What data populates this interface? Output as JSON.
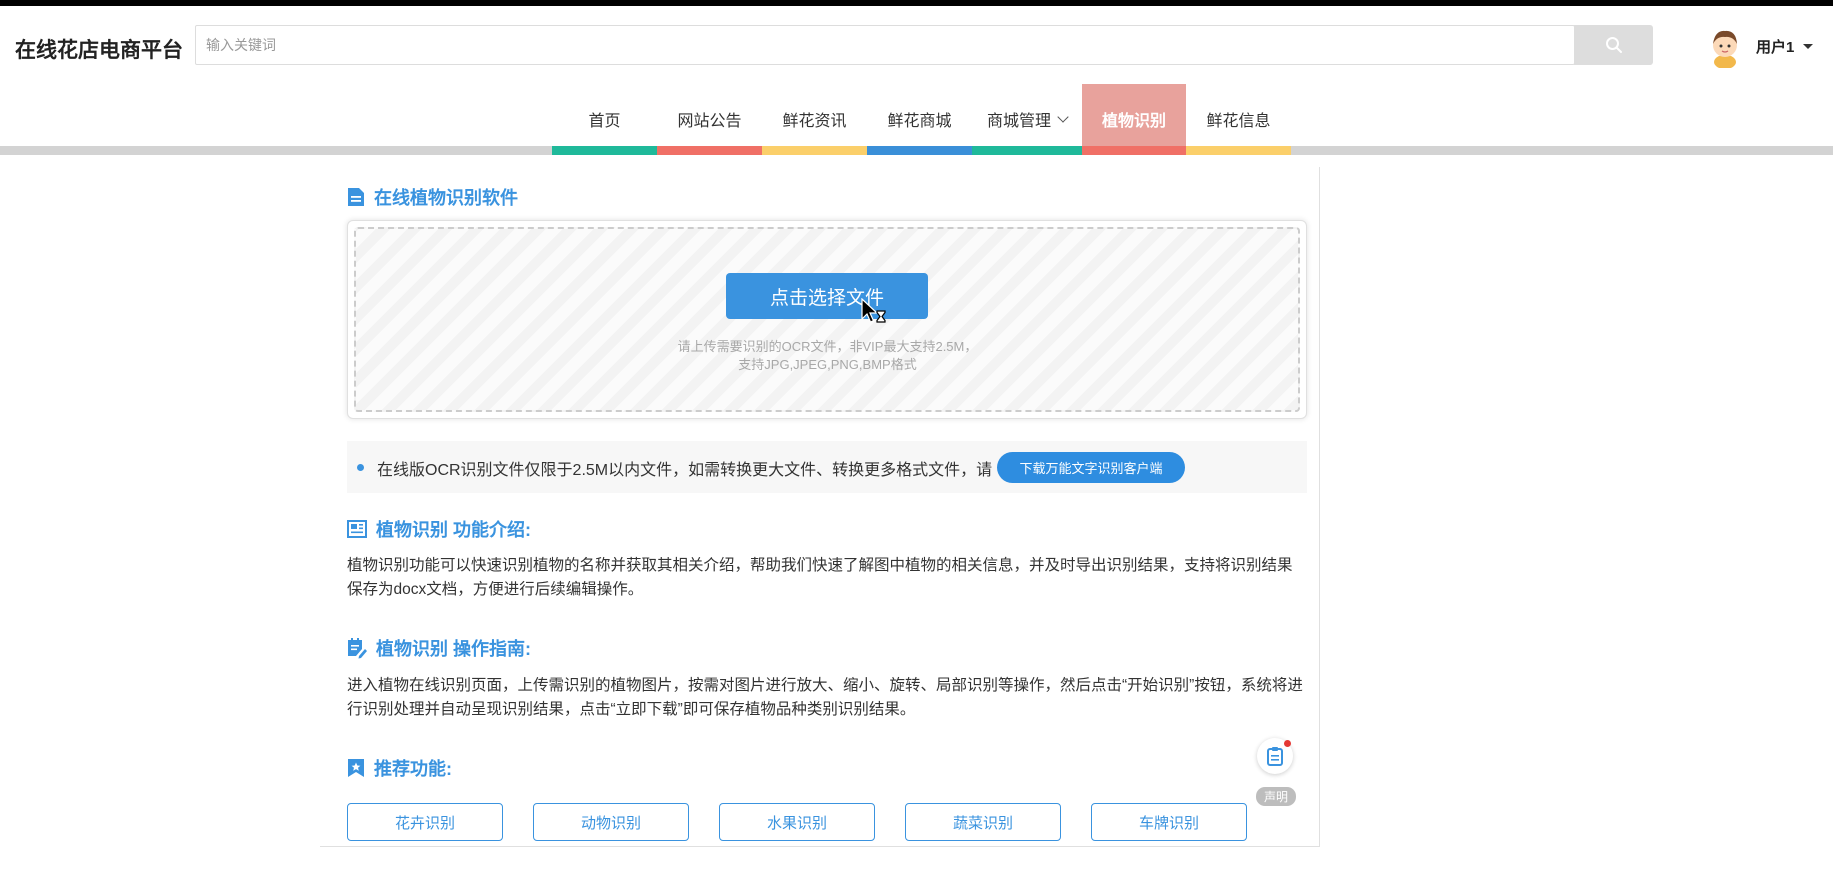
{
  "header": {
    "site_title": "在线花店电商平台",
    "search_placeholder": "输入关键词",
    "user_name": "用户1"
  },
  "nav": {
    "items": [
      {
        "label": "首页",
        "color": "#1fb99a"
      },
      {
        "label": "网站公告",
        "color": "#f07066"
      },
      {
        "label": "鲜花资讯",
        "color": "#fbcf6a"
      },
      {
        "label": "鲜花商城",
        "color": "#3a8fd8"
      },
      {
        "label": "商城管理",
        "color": "#1fb99a"
      },
      {
        "label": "植物识别",
        "color": "#f07066",
        "active": true
      },
      {
        "label": "鲜花信息",
        "color": "#fbcf6a"
      }
    ]
  },
  "main": {
    "section_upload_title": "在线植物识别软件",
    "upload_button": "点击选择文件",
    "upload_hint_line1": "请上传需要识别的OCR文件，非VIP最大支持2.5M，",
    "upload_hint_line2": "支持JPG,JPEG,PNG,BMP格式",
    "notice_text": "在线版OCR识别文件仅限于2.5M以内文件，如需转换更大文件、转换更多格式文件，请",
    "notice_button": "下载万能文字识别客户端",
    "intro_title": "植物识别 功能介绍:",
    "intro_text": "植物识别功能可以快速识别植物的名称并获取其相关介绍，帮助我们快速了解图中植物的相关信息，并及时导出识别结果，支持将识别结果保存为docx文档，方便进行后续编辑操作。",
    "guide_title": "植物识别 操作指南:",
    "guide_text": "进入植物在线识别页面，上传需识别的植物图片，按需对图片进行放大、缩小、旋转、局部识别等操作，然后点击“开始识别”按钮，系统将进行识别处理并自动呈现识别结果，点击“立即下载”即可保存植物品种类别识别结果。",
    "recommend_title": "推荐功能:",
    "recommend_buttons": [
      "花卉识别",
      "动物识别",
      "水果识别",
      "蔬菜识别",
      "车牌识别"
    ]
  },
  "float": {
    "label": "声明"
  },
  "colors": {
    "accent": "#3a93df",
    "active_nav": "#e8a29c"
  }
}
